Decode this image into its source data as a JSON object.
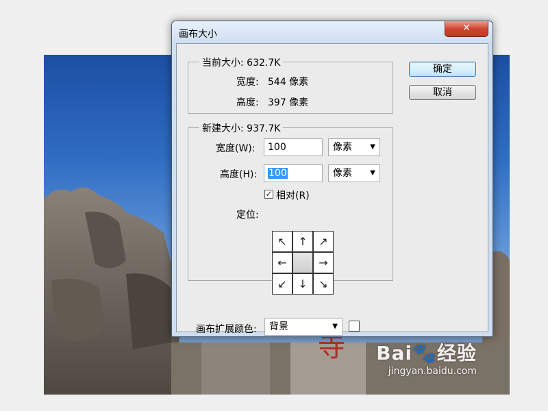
{
  "dialog": {
    "title": "画布大小",
    "close_glyph": "✕",
    "current_size": {
      "legend": "当前大小: 632.7K",
      "width_label": "宽度:",
      "width_value": "544 像素",
      "height_label": "高度:",
      "height_value": "397 像素"
    },
    "new_size": {
      "legend": "新建大小: 937.7K",
      "width_label": "宽度(W):",
      "width_value": "100",
      "width_unit": "像素",
      "height_label": "高度(H):",
      "height_value": "100",
      "height_unit": "像素",
      "relative_label": "相对(R)",
      "relative_checked": "✓",
      "anchor_label": "定位:",
      "anchor_arrows": [
        "↖",
        "↑",
        "↗",
        "←",
        "",
        "→",
        "↙",
        "↓",
        "↘"
      ]
    },
    "extension_color_label": "画布扩展颜色:",
    "extension_color_value": "背景",
    "dropdown_glyph": "▼",
    "ok_label": "确定",
    "cancel_label": "取消"
  },
  "watermark": {
    "brand": "Bai",
    "brand_suffix": "经验",
    "url": "jingyan.baidu.com"
  },
  "colors": {
    "sky_top": "#1c4fa3",
    "rock": "#6b645c",
    "seal_red": "#a83226"
  },
  "icons": {
    "paw": "paw-icon",
    "dropdown": "chevron-down-icon"
  }
}
